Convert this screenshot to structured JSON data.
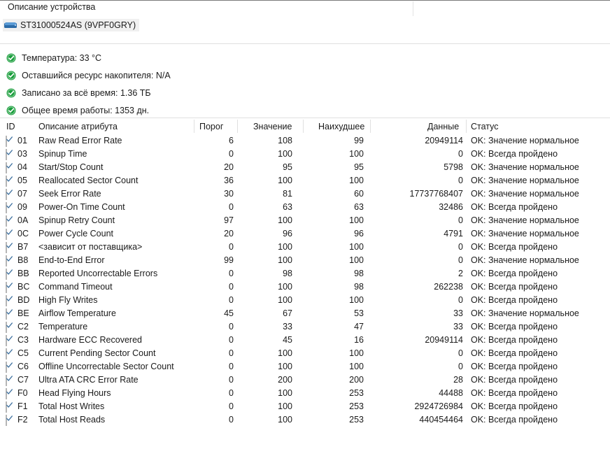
{
  "header": {
    "title": "Описание устройства",
    "device_name": "ST31000524AS (9VPF0GRY)",
    "disk_icon": "hard-disk-icon"
  },
  "summary": {
    "status_icon": "green-check-circle-icon",
    "items": [
      {
        "label": "Температура: 33 °C"
      },
      {
        "label": "Оставшийся ресурс накопителя: N/A"
      },
      {
        "label": "Записано за всё время: 1.36 ТБ"
      },
      {
        "label": "Общее время работы: 1353 дн."
      }
    ]
  },
  "table": {
    "columns": {
      "id": "ID",
      "name": "Описание атрибута",
      "threshold": "Порог",
      "value": "Значение",
      "worst": "Наихудшее",
      "data": "Данные",
      "status": "Статус"
    },
    "rows": [
      {
        "id": "01",
        "name": "Raw Read Error Rate",
        "threshold": "6",
        "value": "108",
        "worst": "99",
        "data": "20949114",
        "status": "OK: Значение нормальное",
        "checked": true
      },
      {
        "id": "03",
        "name": "Spinup Time",
        "threshold": "0",
        "value": "100",
        "worst": "100",
        "data": "0",
        "status": "OK: Всегда пройдено",
        "checked": true
      },
      {
        "id": "04",
        "name": "Start/Stop Count",
        "threshold": "20",
        "value": "95",
        "worst": "95",
        "data": "5798",
        "status": "OK: Значение нормальное",
        "checked": true
      },
      {
        "id": "05",
        "name": "Reallocated Sector Count",
        "threshold": "36",
        "value": "100",
        "worst": "100",
        "data": "0",
        "status": "OK: Значение нормальное",
        "checked": true
      },
      {
        "id": "07",
        "name": "Seek Error Rate",
        "threshold": "30",
        "value": "81",
        "worst": "60",
        "data": "17737768407",
        "status": "OK: Значение нормальное",
        "checked": true
      },
      {
        "id": "09",
        "name": "Power-On Time Count",
        "threshold": "0",
        "value": "63",
        "worst": "63",
        "data": "32486",
        "status": "OK: Всегда пройдено",
        "checked": true
      },
      {
        "id": "0A",
        "name": "Spinup Retry Count",
        "threshold": "97",
        "value": "100",
        "worst": "100",
        "data": "0",
        "status": "OK: Значение нормальное",
        "checked": true
      },
      {
        "id": "0C",
        "name": "Power Cycle Count",
        "threshold": "20",
        "value": "96",
        "worst": "96",
        "data": "4791",
        "status": "OK: Значение нормальное",
        "checked": true
      },
      {
        "id": "B7",
        "name": "<зависит от поставщика>",
        "threshold": "0",
        "value": "100",
        "worst": "100",
        "data": "0",
        "status": "OK: Всегда пройдено",
        "checked": true
      },
      {
        "id": "B8",
        "name": "End-to-End Error",
        "threshold": "99",
        "value": "100",
        "worst": "100",
        "data": "0",
        "status": "OK: Значение нормальное",
        "checked": true
      },
      {
        "id": "BB",
        "name": "Reported Uncorrectable Errors",
        "threshold": "0",
        "value": "98",
        "worst": "98",
        "data": "2",
        "status": "OK: Всегда пройдено",
        "checked": true
      },
      {
        "id": "BC",
        "name": "Command Timeout",
        "threshold": "0",
        "value": "100",
        "worst": "98",
        "data": "262238",
        "status": "OK: Всегда пройдено",
        "checked": true
      },
      {
        "id": "BD",
        "name": "High Fly Writes",
        "threshold": "0",
        "value": "100",
        "worst": "100",
        "data": "0",
        "status": "OK: Всегда пройдено",
        "checked": true
      },
      {
        "id": "BE",
        "name": "Airflow Temperature",
        "threshold": "45",
        "value": "67",
        "worst": "53",
        "data": "33",
        "status": "OK: Значение нормальное",
        "checked": true
      },
      {
        "id": "C2",
        "name": "Temperature",
        "threshold": "0",
        "value": "33",
        "worst": "47",
        "data": "33",
        "status": "OK: Всегда пройдено",
        "checked": true
      },
      {
        "id": "C3",
        "name": "Hardware ECC Recovered",
        "threshold": "0",
        "value": "45",
        "worst": "16",
        "data": "20949114",
        "status": "OK: Всегда пройдено",
        "checked": true
      },
      {
        "id": "C5",
        "name": "Current Pending Sector Count",
        "threshold": "0",
        "value": "100",
        "worst": "100",
        "data": "0",
        "status": "OK: Всегда пройдено",
        "checked": true
      },
      {
        "id": "C6",
        "name": "Offline Uncorrectable Sector Count",
        "threshold": "0",
        "value": "100",
        "worst": "100",
        "data": "0",
        "status": "OK: Всегда пройдено",
        "checked": true
      },
      {
        "id": "C7",
        "name": "Ultra ATA CRC Error Rate",
        "threshold": "0",
        "value": "200",
        "worst": "200",
        "data": "28",
        "status": "OK: Всегда пройдено",
        "checked": true
      },
      {
        "id": "F0",
        "name": "Head Flying Hours",
        "threshold": "0",
        "value": "100",
        "worst": "253",
        "data": "44488",
        "status": "OK: Всегда пройдено",
        "checked": true
      },
      {
        "id": "F1",
        "name": "Total Host Writes",
        "threshold": "0",
        "value": "100",
        "worst": "253",
        "data": "2924726984",
        "status": "OK: Всегда пройдено",
        "checked": true
      },
      {
        "id": "F2",
        "name": "Total Host Reads",
        "threshold": "0",
        "value": "100",
        "worst": "253",
        "data": "440454464",
        "status": "OK: Всегда пройдено",
        "checked": true
      }
    ]
  },
  "colors": {
    "status_green": "#1a9e3c",
    "disk_blue": "#2d6ca8",
    "checkbox_tick": "#3c6f9e",
    "rule": "#e0e0e0",
    "top_rule": "#7a7a7a"
  }
}
